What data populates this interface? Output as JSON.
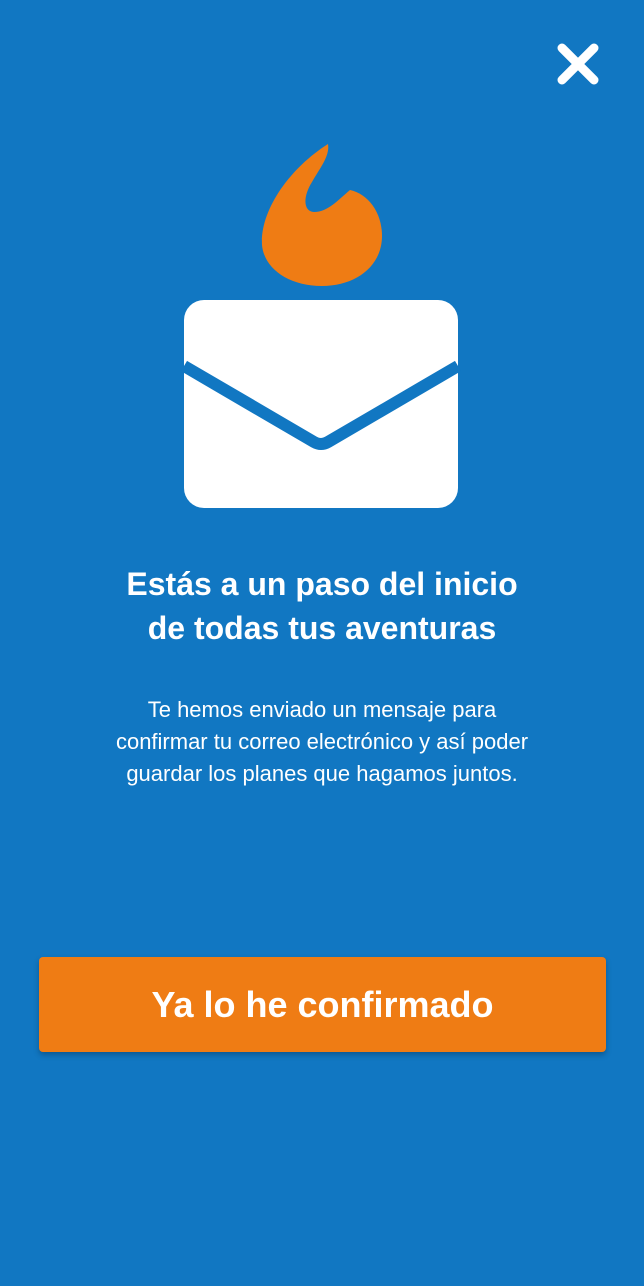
{
  "colors": {
    "background": "#1177C2",
    "accent": "#EF7C14",
    "text": "#FFFFFF"
  },
  "icons": {
    "close": "close-icon",
    "flame": "flame-icon",
    "envelope": "envelope-icon"
  },
  "header": {
    "title": "Estás a un paso del inicio\nde todas tus aventuras"
  },
  "body": {
    "message": "Te hemos enviado un mensaje para\nconfirmar tu correo electrónico y así poder\nguardar los planes que hagamos juntos."
  },
  "actions": {
    "confirm_label": "Ya lo he confirmado"
  }
}
